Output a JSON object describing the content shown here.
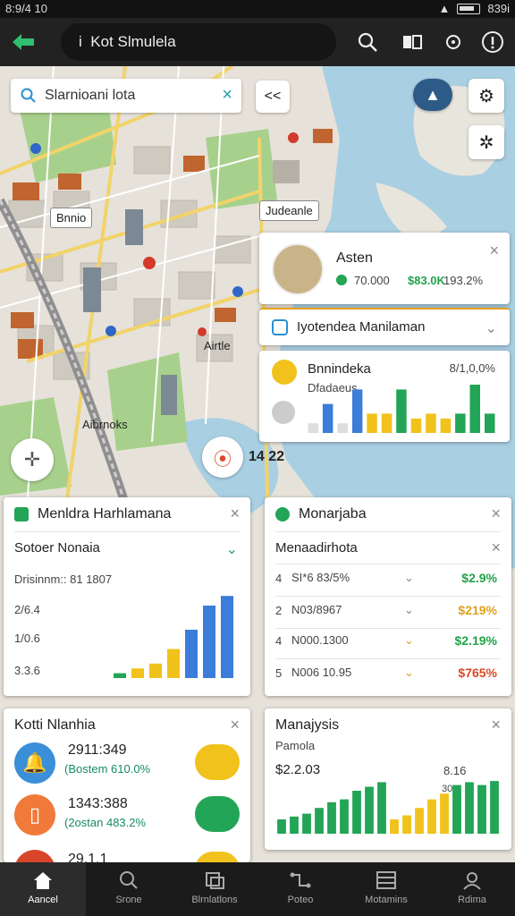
{
  "status": {
    "time": "8:9/4 10",
    "battery_text": "839i"
  },
  "app": {
    "title": "Kot Slmulela",
    "title_prefix": "i"
  },
  "search": {
    "value": "Slarnioani lota"
  },
  "map": {
    "label_top": "Judeanle",
    "label_left1": "Bnnio",
    "label_left2": "Aibrnoks",
    "label_center": "Airtle",
    "label_pin": "14 22"
  },
  "poi_card": {
    "name": "Asten",
    "rating": "70.000",
    "price": "$83.0K",
    "change": "193.2%"
  },
  "route_bar": {
    "text": "Iyotendea Manilaman"
  },
  "stats_card": {
    "title": "Bnnindeka",
    "subtitle": "Dfadaeus",
    "percent": "8/1,0,0%"
  },
  "left_panel": {
    "header": "Menldra Harhlamana",
    "subheader": "Sotoer Nonaia",
    "stat_row": "Drisinnm:: 81 1807",
    "rows": [
      "2/6.4",
      "1/0.6",
      "3.3.6"
    ]
  },
  "right_panel": {
    "header": "Monarjaba",
    "subheader": "Menaadirhota",
    "rows": [
      {
        "num": "4",
        "label": "SI*6 83/5%",
        "value": "$2.9%",
        "color": "#21a34a",
        "arrow": "orange"
      },
      {
        "num": "2",
        "label": "N03/8967",
        "value": "$219%",
        "color": "#e0a11a",
        "arrow": "orange"
      },
      {
        "num": "4",
        "label": "N000.1300",
        "value": "$2.19%",
        "color": "#21a34a",
        "arrow": "orange"
      },
      {
        "num": "5",
        "label": "N006 10.95",
        "value": "$765%",
        "color": "#d84a26",
        "arrow": "orange"
      }
    ]
  },
  "bottom_left": {
    "header": "Kotti Nlanhia",
    "items": [
      {
        "value": "2911:349",
        "sub": "(Bostem 610.0%",
        "icon": "bell-icon",
        "circle": "#3b8fd9",
        "badge_color": "#f1c21b"
      },
      {
        "value": "1343:388",
        "sub": "(2ostan 483.2%",
        "icon": "document-icon",
        "circle": "#f07a3a",
        "badge_color": "#22a556"
      },
      {
        "value": "29.1.1",
        "sub": "",
        "icon": "alert-icon",
        "circle": "#d8452b",
        "badge_color": "#f1c21b"
      }
    ]
  },
  "bottom_right": {
    "header": "Manajysis",
    "sub": "Pamola",
    "left_value": "$2.2.03",
    "right_value": "8.16",
    "right_small": "30"
  },
  "nav": {
    "items": [
      {
        "label": "Aancel",
        "icon": "home-icon"
      },
      {
        "label": "Srone",
        "icon": "search-icon"
      },
      {
        "label": "Blrnlatlons",
        "icon": "layers-icon"
      },
      {
        "label": "Poteo",
        "icon": "route-icon"
      },
      {
        "label": "Motamins",
        "icon": "list-icon"
      },
      {
        "label": "Rdima",
        "icon": "profile-icon"
      }
    ]
  },
  "chart_data": [
    {
      "type": "bar",
      "values": [
        0.2,
        0.6,
        0.2,
        0.9,
        0.4,
        0.4,
        0.9,
        0.3,
        0.4,
        0.3,
        0.4,
        1.0,
        0.4
      ],
      "colors": [
        "#ddd",
        "#3b7dd8",
        "#ddd",
        "#3b7dd8",
        "#f1c21b",
        "#f1c21b",
        "#22a556",
        "#f1c21b",
        "#f1c21b",
        "#f1c21b",
        "#22a556",
        "#22a556",
        "#22a556"
      ]
    },
    {
      "type": "bar",
      "values": [
        0.05,
        0.1,
        0.15,
        0.3,
        0.5,
        0.75,
        0.85
      ],
      "colors": [
        "#22a556",
        "#f1c21b",
        "#f1c21b",
        "#f1c21b",
        "#3b7dd8",
        "#3b7dd8",
        "#3b7dd8"
      ]
    },
    {
      "type": "bar",
      "values": [
        0.25,
        0.3,
        0.35,
        0.45,
        0.55,
        0.6,
        0.75,
        0.82,
        0.9,
        0.25,
        0.32,
        0.45,
        0.6,
        0.7,
        0.85,
        0.9,
        0.85,
        0.92
      ],
      "colors": [
        "#22a556",
        "#22a556",
        "#22a556",
        "#22a556",
        "#22a556",
        "#22a556",
        "#22a556",
        "#22a556",
        "#22a556",
        "#f1c21b",
        "#f1c21b",
        "#f1c21b",
        "#f1c21b",
        "#f1c21b",
        "#22a556",
        "#22a556",
        "#22a556",
        "#22a556"
      ]
    }
  ]
}
